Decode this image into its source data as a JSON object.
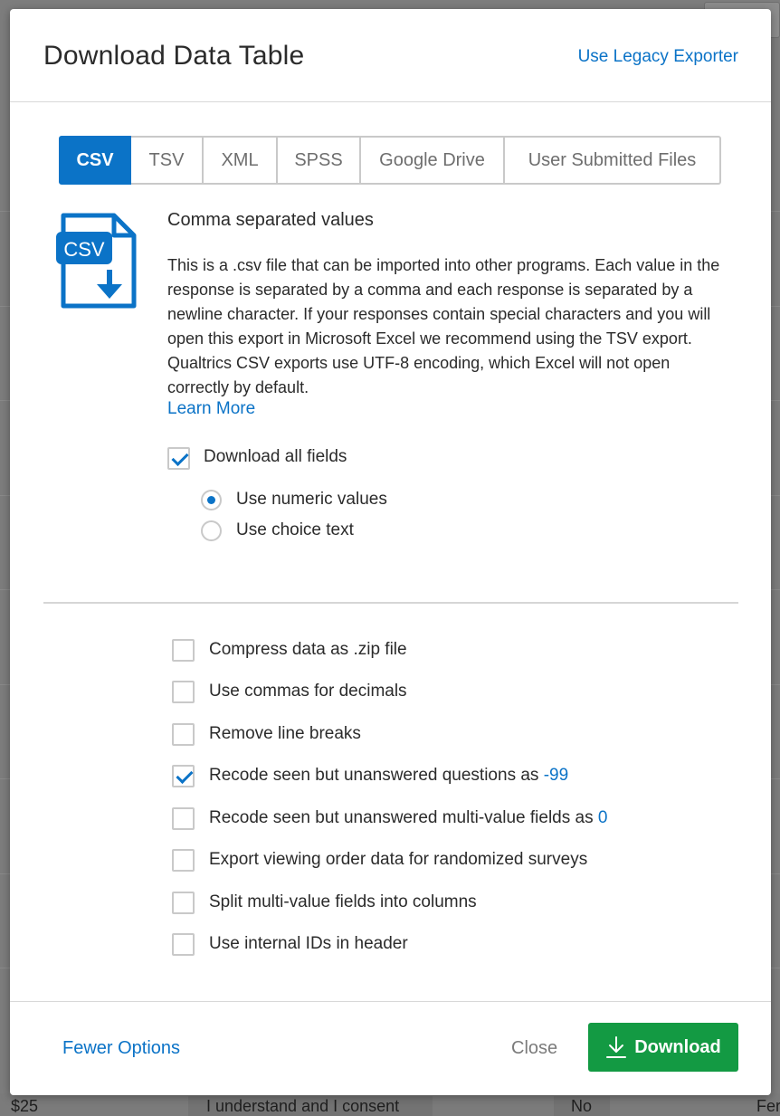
{
  "modal": {
    "title": "Download Data Table",
    "legacy_link": "Use Legacy Exporter"
  },
  "tabs": [
    {
      "label": "CSV",
      "active": true
    },
    {
      "label": "TSV",
      "active": false
    },
    {
      "label": "XML",
      "active": false
    },
    {
      "label": "SPSS",
      "active": false
    },
    {
      "label": "Google Drive",
      "active": false
    },
    {
      "label": "User Submitted Files",
      "active": false
    }
  ],
  "format": {
    "icon_label": "CSV",
    "icon": "csv-file-download-icon",
    "title": "Comma separated values",
    "description": "This is a .csv file that can be imported into other programs. Each value in the response is separated by a comma and each response is separated by a newline character. If your responses contain special characters and you will open this export in Microsoft Excel we recommend using the TSV export. Qualtrics CSV exports use UTF-8 encoding, which Excel will not open correctly by default.",
    "learn_more": "Learn More"
  },
  "download_all_fields": {
    "label": "Download all fields",
    "checked": true
  },
  "value_mode": [
    {
      "label": "Use numeric values",
      "selected": true
    },
    {
      "label": "Use choice text",
      "selected": false
    }
  ],
  "options": [
    {
      "label": "Compress data as .zip file",
      "checked": false
    },
    {
      "label": "Use commas for decimals",
      "checked": false
    },
    {
      "label": "Remove line breaks",
      "checked": false
    },
    {
      "label": "Recode seen but unanswered questions as",
      "value": "-99",
      "checked": true
    },
    {
      "label": "Recode seen but unanswered multi-value fields as",
      "value": "0",
      "checked": false
    },
    {
      "label": "Export viewing order data for randomized surveys",
      "checked": false
    },
    {
      "label": "Split multi-value fields into columns",
      "checked": false
    },
    {
      "label": "Use internal IDs in header",
      "checked": false
    }
  ],
  "footer": {
    "fewer_options": "Fewer Options",
    "close": "Close",
    "download": "Download"
  },
  "background": {
    "bottom_row": [
      "$25",
      "I understand and I consent",
      "No",
      "Fer"
    ]
  },
  "colors": {
    "accent": "#0b73c7",
    "download_green": "#139a43"
  }
}
